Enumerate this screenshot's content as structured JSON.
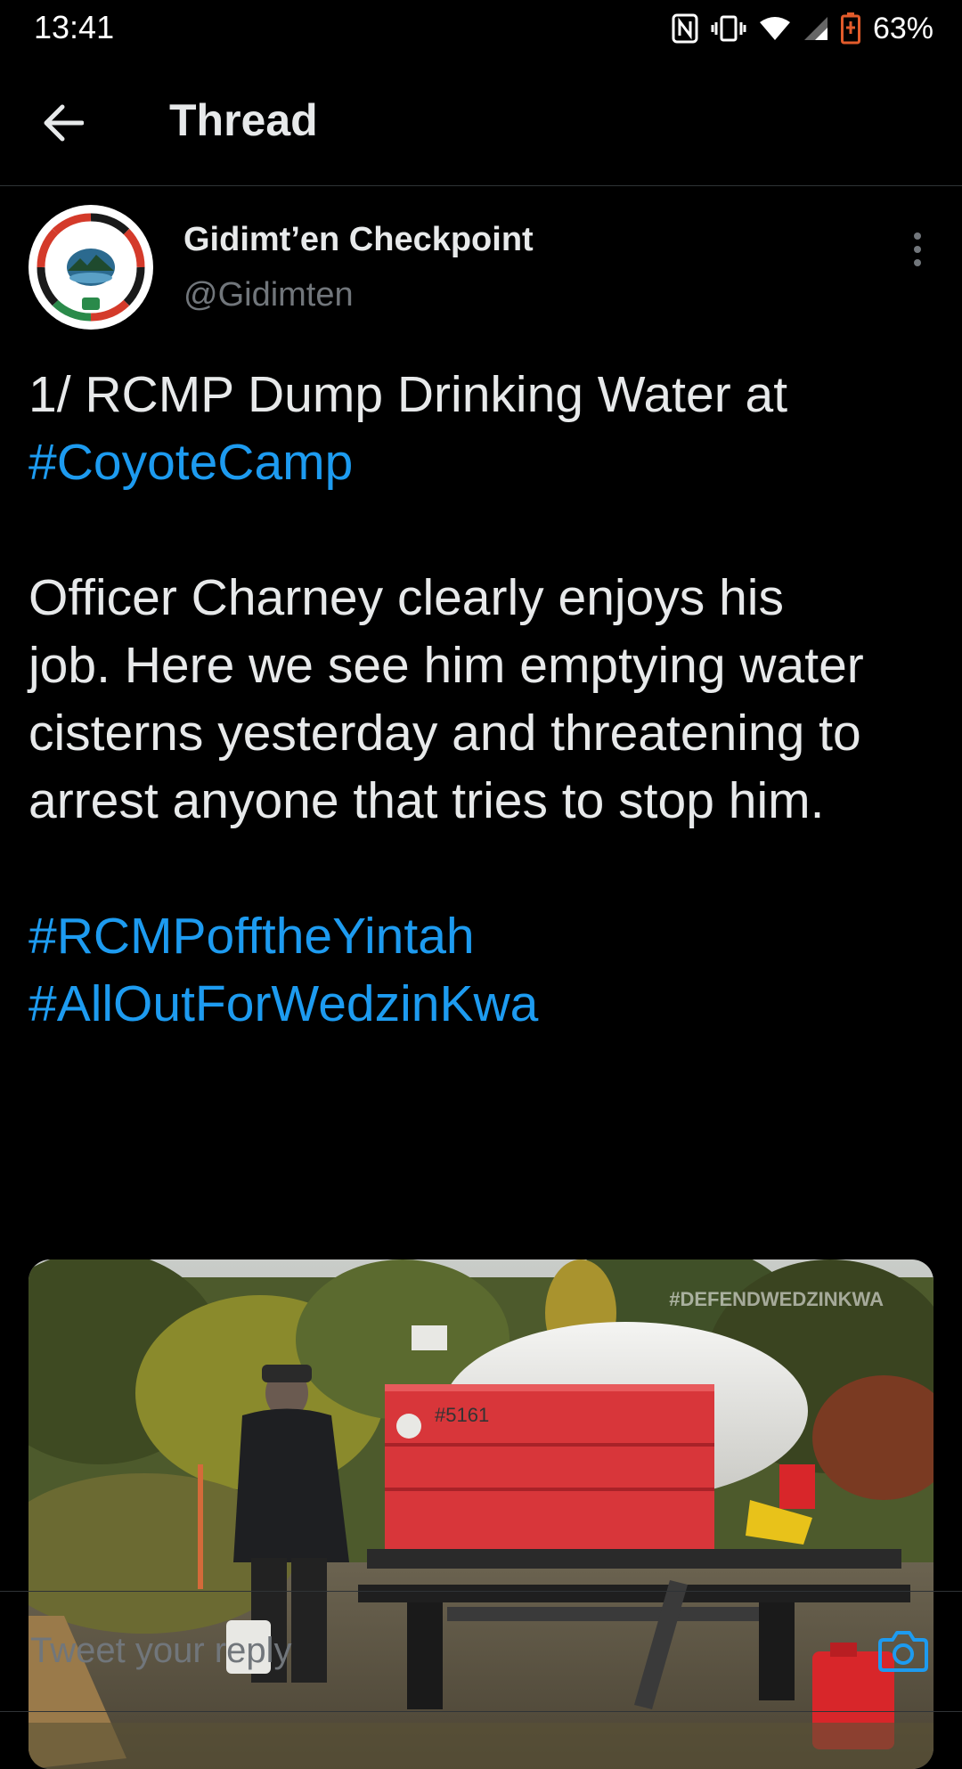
{
  "status_bar": {
    "time": "13:41",
    "battery": "63%",
    "icons": [
      "nfc-icon",
      "vibrate-icon",
      "wifi-icon",
      "signal-icon",
      "battery-icon"
    ]
  },
  "header": {
    "title": "Thread",
    "back_icon": "arrow-left-icon"
  },
  "tweet": {
    "author_name": "Gidimt’en Checkpoint",
    "author_handle": "@Gidimten",
    "text_line1": "1/ RCMP Dump Drinking Water at",
    "hashtag1": "#CoyoteCamp",
    "body_lines": [
      "Officer Charney clearly enjoys his",
      "job. Here we see him emptying water",
      "cisterns yesterday and threatening to",
      "arrest anyone that tries to stop him."
    ],
    "hashtag2": "#RCMPofftheYintah",
    "hashtag3": "#AllOutForWedzinKwa",
    "media": {
      "watermark": "#DEFENDWEDZINKWA",
      "tank_label": "#5161"
    }
  },
  "reply": {
    "placeholder": "Tweet your reply",
    "camera_icon": "camera-icon"
  },
  "colors": {
    "background": "#000000",
    "text": "#e7e9ea",
    "secondary": "#71767b",
    "accent": "#1d9bf0",
    "divider": "#2f3336"
  }
}
